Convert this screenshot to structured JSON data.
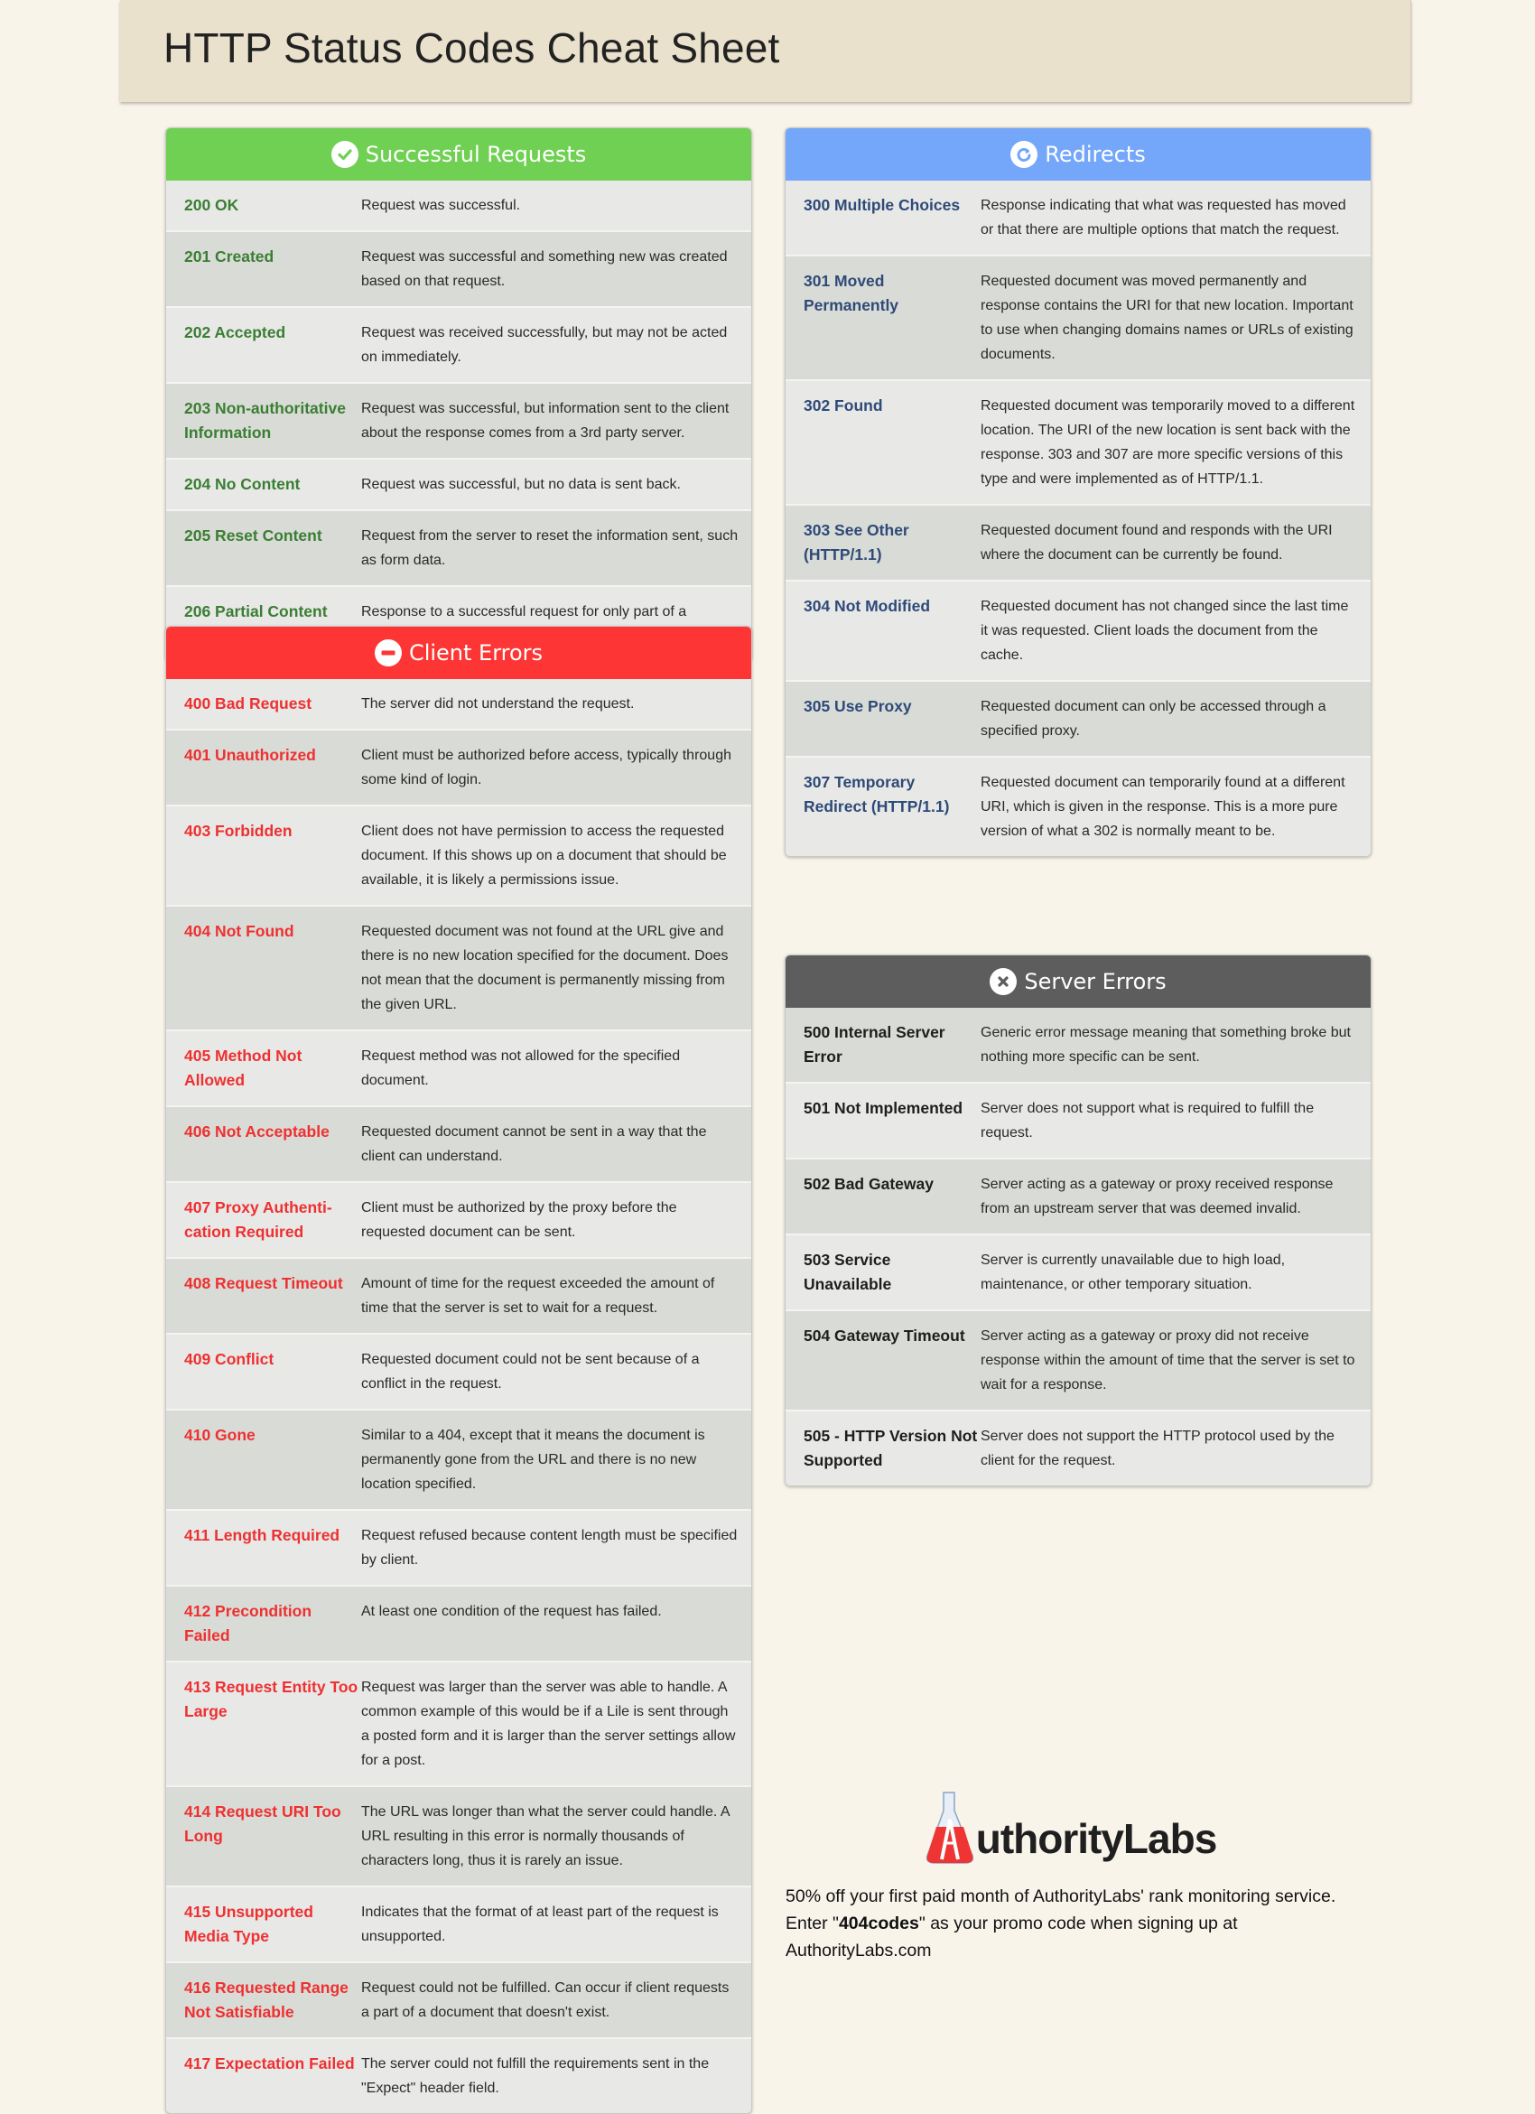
{
  "page": {
    "title": "HTTP Status Codes Cheat Sheet"
  },
  "sections": {
    "success": {
      "title": "Successful Requests",
      "icon": "check-circle-icon",
      "color": "#6fd053",
      "rows": [
        {
          "code": "200 OK",
          "desc": "Request was successful."
        },
        {
          "code": "201 Created",
          "desc": "Request was successful and something new was created based on that request."
        },
        {
          "code": "202 Accepted",
          "desc": "Request was received successfully, but may not be acted on immediately."
        },
        {
          "code": "203 Non-authoritative Information",
          "desc": "Request was successful, but information sent to the client about the response comes from a 3rd party server."
        },
        {
          "code": "204 No Content",
          "desc": "Request was successful, but no data is sent back."
        },
        {
          "code": "205 Reset Content",
          "desc": "Request from the server to reset the information sent, such as form data."
        },
        {
          "code": "206 Partial Content",
          "desc": "Response to a successful request for only part of a document."
        }
      ]
    },
    "client": {
      "title": "Client Errors",
      "icon": "no-entry-icon",
      "color": "#fd3635",
      "rows": [
        {
          "code": "400 Bad Request",
          "desc": "The server did not understand the request."
        },
        {
          "code": "401 Unauthorized",
          "desc": "Client must be authorized before access, typically through some kind of login."
        },
        {
          "code": "403 Forbidden",
          "desc": "Client does not have permission to access the requested document.  If this shows up on a document that should be available, it is likely a permissions issue."
        },
        {
          "code": "404 Not Found",
          "desc": "Requested document was not found at the URL give and there is no new location specified for the document. Does not mean that the document is permanently missing from the given URL."
        },
        {
          "code": "405 Method Not Allowed",
          "desc": "Request method was not allowed for the specified document."
        },
        {
          "code": "406 Not Acceptable",
          "desc": "Requested document cannot be sent in a way that the client can understand."
        },
        {
          "code": "407 Proxy Authenti-cation Required",
          "desc": "Client must be authorized by the proxy before the requested document can be sent."
        },
        {
          "code": "408 Request Timeout",
          "desc": "Amount of time for the request exceeded the amount of time that the server is set to wait for a request."
        },
        {
          "code": "409 Conflict",
          "desc": "Requested document could not be sent because of a conflict in the request."
        },
        {
          "code": "410 Gone",
          "desc": "Similar to a 404, except that it means the document is permanently gone from the URL and there is no new location specified."
        },
        {
          "code": "411 Length Required",
          "desc": "Request refused because content length must be specified by client."
        },
        {
          "code": "412 Precondition Failed",
          "desc": "At least one condition of the request has failed."
        },
        {
          "code": "413 Request Entity Too Large",
          "desc": "Request was larger than the server was able to handle. A common example of this would be if a Lile is sent through a posted form and it is larger      than the server settings allow for a post."
        },
        {
          "code": "414 Request URI Too Long",
          "desc": "The URL was longer than what the server could handle. A URL resulting in this error is normally thousands of characters long, thus it is rarely an issue."
        },
        {
          "code": "415 Unsupported Media Type",
          "desc": "Indicates that the format of at least part of the request is unsupported."
        },
        {
          "code": "416 Requested Range Not Satisfiable",
          "desc": "Request could not be fulfilled. Can occur if client requests a part of a document that doesn't exist."
        },
        {
          "code": "417 Expectation Failed",
          "desc": "The server could not fulfill the requirements sent in the \"Expect\" header field."
        }
      ]
    },
    "redirect": {
      "title": "Redirects",
      "icon": "refresh-icon",
      "color": "#74a6f9",
      "rows": [
        {
          "code": "300 Multiple Choices",
          "desc": "Response indicating that what was requested has moved or that there are multiple options that match the request."
        },
        {
          "code": "301 Moved Permanently",
          "desc": "Requested document was moved permanently and response contains the URI for that new location. Important to use when changing   domains names or URLs of existing documents."
        },
        {
          "code": "302 Found",
          "desc": "Requested document was temporarily moved to a different location.  The URI of the new location is sent back with the response. 303 and 307 are more specific versions of this type and were implemented as of HTTP/1.1."
        },
        {
          "code": "303 See Other (HTTP/1.1)",
          "desc": "Requested document found and responds with the URI where the document can be currently be found."
        },
        {
          "code": "304 Not Modified",
          "desc": "Requested document has not changed since the last time it was requested. Client loads the document from the cache."
        },
        {
          "code": "305 Use Proxy",
          "desc": "Requested document can only be accessed through a specified proxy."
        },
        {
          "code": "307 Temporary Redirect (HTTP/1.1)",
          "desc": "Requested document can temporarily found at a different URI, which is given in the response. This is a more pure version of what a 302 is normally meant to be."
        }
      ]
    },
    "server": {
      "title": "Server Errors",
      "icon": "x-circle-icon",
      "color": "#5d5d5d",
      "rows": [
        {
          "code": "500 Internal Server Error",
          "desc": "Generic error message meaning that something broke but nothing more specific can be sent."
        },
        {
          "code": "501 Not Implemented",
          "desc": "Server does not support what is required to fulfill the request."
        },
        {
          "code": "502 Bad Gateway",
          "desc": "Server acting as a gateway or proxy received response from an upstream server that was deemed invalid."
        },
        {
          "code": "503 Service Unavailable",
          "desc": "Server is currently unavailable due to high load, maintenance, or other temporary situation."
        },
        {
          "code": "504 Gateway Timeout",
          "desc": "Server acting as a gateway or proxy did not receive response within the amount of time that the server is set to wait for a response."
        },
        {
          "code": "505 - HTTP Version Not Supported",
          "desc": "Server does not support the HTTP protocol used by the client for the request."
        }
      ]
    }
  },
  "footer": {
    "logo_text": "uthorityLabs",
    "logo_icon": "flask-icon",
    "promo_before": "50% off your first paid month of AuthorityLabs' rank monitoring service. Enter \"",
    "promo_code": "404codes",
    "promo_after": "\" as your promo code when signing up at AuthorityLabs.com"
  }
}
